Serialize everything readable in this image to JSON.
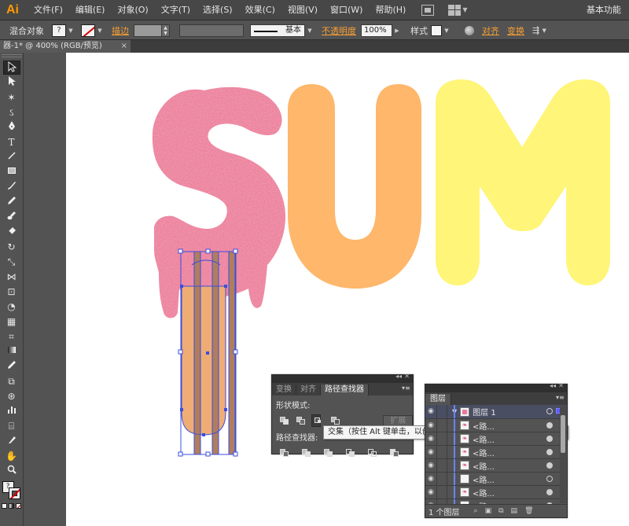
{
  "app": {
    "logo": "Ai",
    "workspace": "基本功能"
  },
  "menu": [
    {
      "label": "文件(F)"
    },
    {
      "label": "编辑(E)"
    },
    {
      "label": "对象(O)"
    },
    {
      "label": "文字(T)"
    },
    {
      "label": "选择(S)"
    },
    {
      "label": "效果(C)"
    },
    {
      "label": "视图(V)"
    },
    {
      "label": "窗口(W)"
    },
    {
      "label": "帮助(H)"
    }
  ],
  "control_bar": {
    "selection_label": "混合对象",
    "fill_symbol": "?",
    "stroke_label": "描边",
    "stroke_style_value": "基本",
    "opacity_label": "不透明度",
    "opacity_value": "100%",
    "style_label": "样式",
    "align_label": "对齐",
    "transform_label": "变换"
  },
  "document": {
    "tab_title": "器-1* @ 400% (RGB/预览)",
    "close_symbol": "×"
  },
  "artwork": {
    "letters": [
      "S",
      "U",
      "M"
    ],
    "colors": {
      "s_pink": "#ea5a86",
      "u_orange": "#feb76b",
      "m_yellow": "#fff578",
      "stripe_brown": "#b07e5e",
      "stick_peach": "#efad75",
      "selection_blue": "#3a4de0"
    }
  },
  "pathfinder_panel": {
    "tabs": [
      {
        "label": "变换"
      },
      {
        "label": "对齐"
      },
      {
        "label": "路径查找器"
      }
    ],
    "shape_modes_label": "形状模式:",
    "expand_label": "扩展",
    "pathfinders_label": "路径查找器:",
    "tooltip": "交集（按住 Alt 键单击，以创建一个复合形状，并与形状区域交叉）"
  },
  "layers_panel": {
    "tab_label": "图层",
    "layer_name": "图层 1",
    "sublayers": [
      {
        "label": "<路..."
      },
      {
        "label": "<路..."
      },
      {
        "label": "<路..."
      },
      {
        "label": "<路..."
      },
      {
        "label": "<路..."
      },
      {
        "label": "<路..."
      },
      {
        "label": "<路..."
      }
    ],
    "footer_count": "1 个图层"
  }
}
